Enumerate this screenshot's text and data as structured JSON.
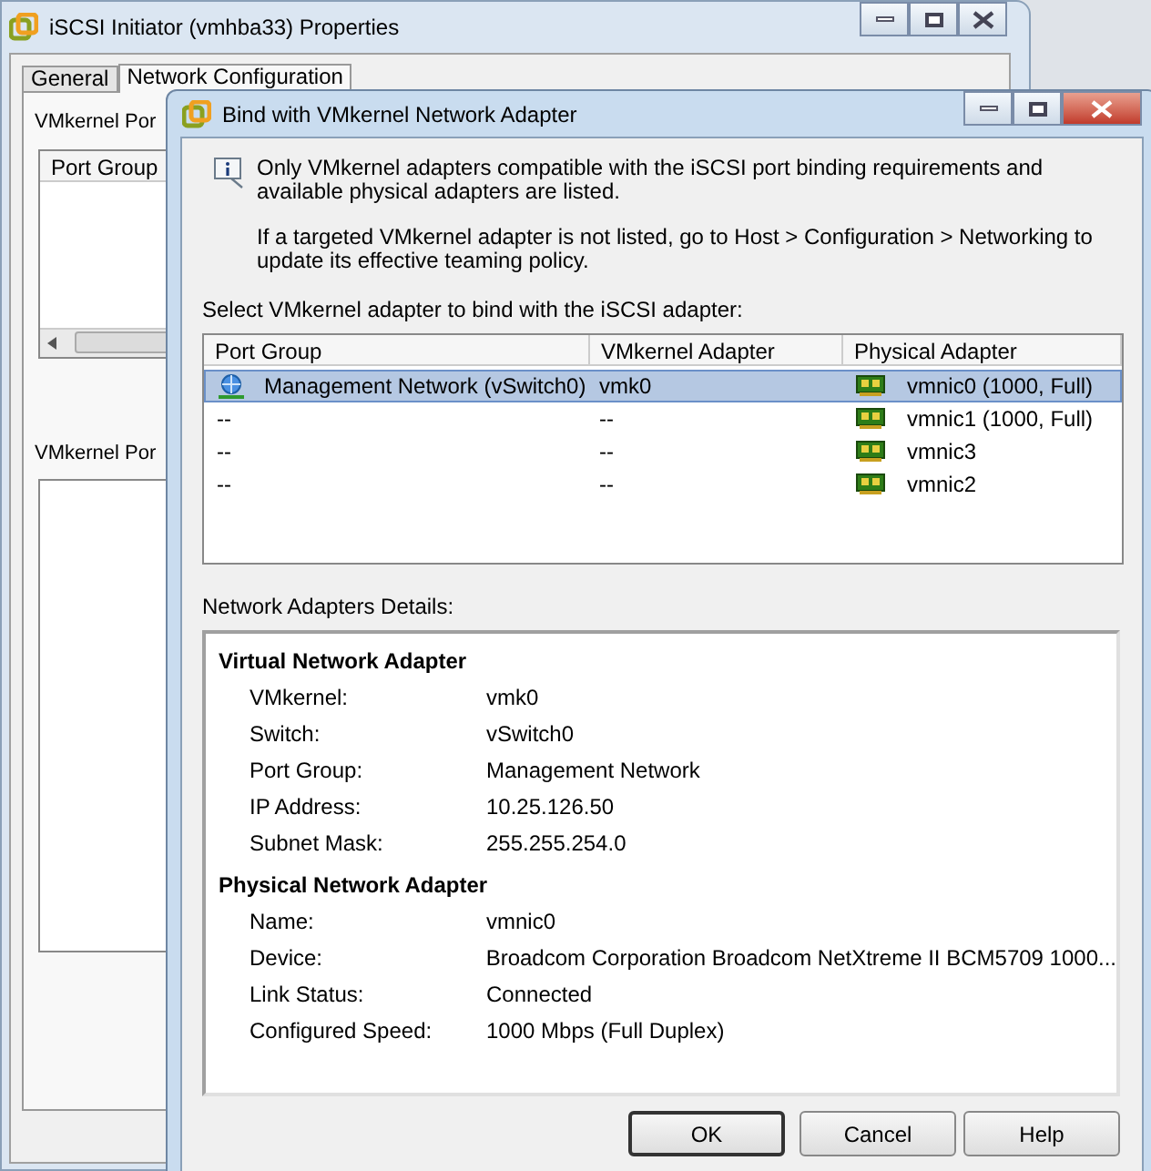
{
  "back_window": {
    "title": "iSCSI Initiator (vmhba33) Properties",
    "tabs": [
      {
        "label": "General",
        "selected": false
      },
      {
        "label": "Network Configuration",
        "selected": true
      }
    ],
    "labels": [
      "VMkernel Por",
      "VMkernel Por"
    ],
    "list_header": "Port Group"
  },
  "dialog": {
    "title": "Bind with VMkernel Network Adapter",
    "info": [
      "Only VMkernel adapters compatible with the iSCSI port binding requirements and available physical adapters are listed.",
      "If a targeted VMkernel adapter is not listed, go to Host > Configuration > Networking to update its effective teaming policy."
    ],
    "select_label": "Select VMkernel adapter to bind with the iSCSI adapter:",
    "table": {
      "columns": [
        "Port Group",
        "VMkernel Adapter",
        "Physical Adapter"
      ],
      "rows": [
        {
          "kind": "portgroup",
          "port_group": "Management Network (vSwitch0)",
          "vmkernel_adapter": "vmk0",
          "physical_adapter": "vmnic0 (1000, Full)",
          "selected": true
        },
        {
          "kind": "none",
          "port_group": "--",
          "vmkernel_adapter": "--",
          "physical_adapter": "vmnic1 (1000, Full)",
          "selected": false
        },
        {
          "kind": "none",
          "port_group": "--",
          "vmkernel_adapter": "--",
          "physical_adapter": "vmnic3",
          "selected": false
        },
        {
          "kind": "none",
          "port_group": "--",
          "vmkernel_adapter": "--",
          "physical_adapter": "vmnic2",
          "selected": false
        }
      ]
    },
    "details_label": "Network Adapters Details:",
    "sections": [
      {
        "heading": "Virtual Network Adapter",
        "fields": [
          {
            "label": "VMkernel:",
            "value": "vmk0"
          },
          {
            "label": "Switch:",
            "value": "vSwitch0"
          },
          {
            "label": "Port Group:",
            "value": "Management Network"
          },
          {
            "label": "IP Address:",
            "value": "10.25.126.50"
          },
          {
            "label": "Subnet Mask:",
            "value": "255.255.254.0"
          }
        ]
      },
      {
        "heading": "Physical Network Adapter",
        "fields": [
          {
            "label": "Name:",
            "value": "vmnic0"
          },
          {
            "label": "Device:",
            "value": "Broadcom Corporation Broadcom NetXtreme II BCM5709 1000..."
          },
          {
            "label": "Link Status:",
            "value": "Connected"
          },
          {
            "label": "Configured Speed:",
            "value": "1000 Mbps (Full Duplex)"
          }
        ]
      }
    ],
    "buttons": [
      {
        "label": "OK",
        "default": true
      },
      {
        "label": "Cancel",
        "default": false
      },
      {
        "label": "Help",
        "default": false
      }
    ]
  }
}
